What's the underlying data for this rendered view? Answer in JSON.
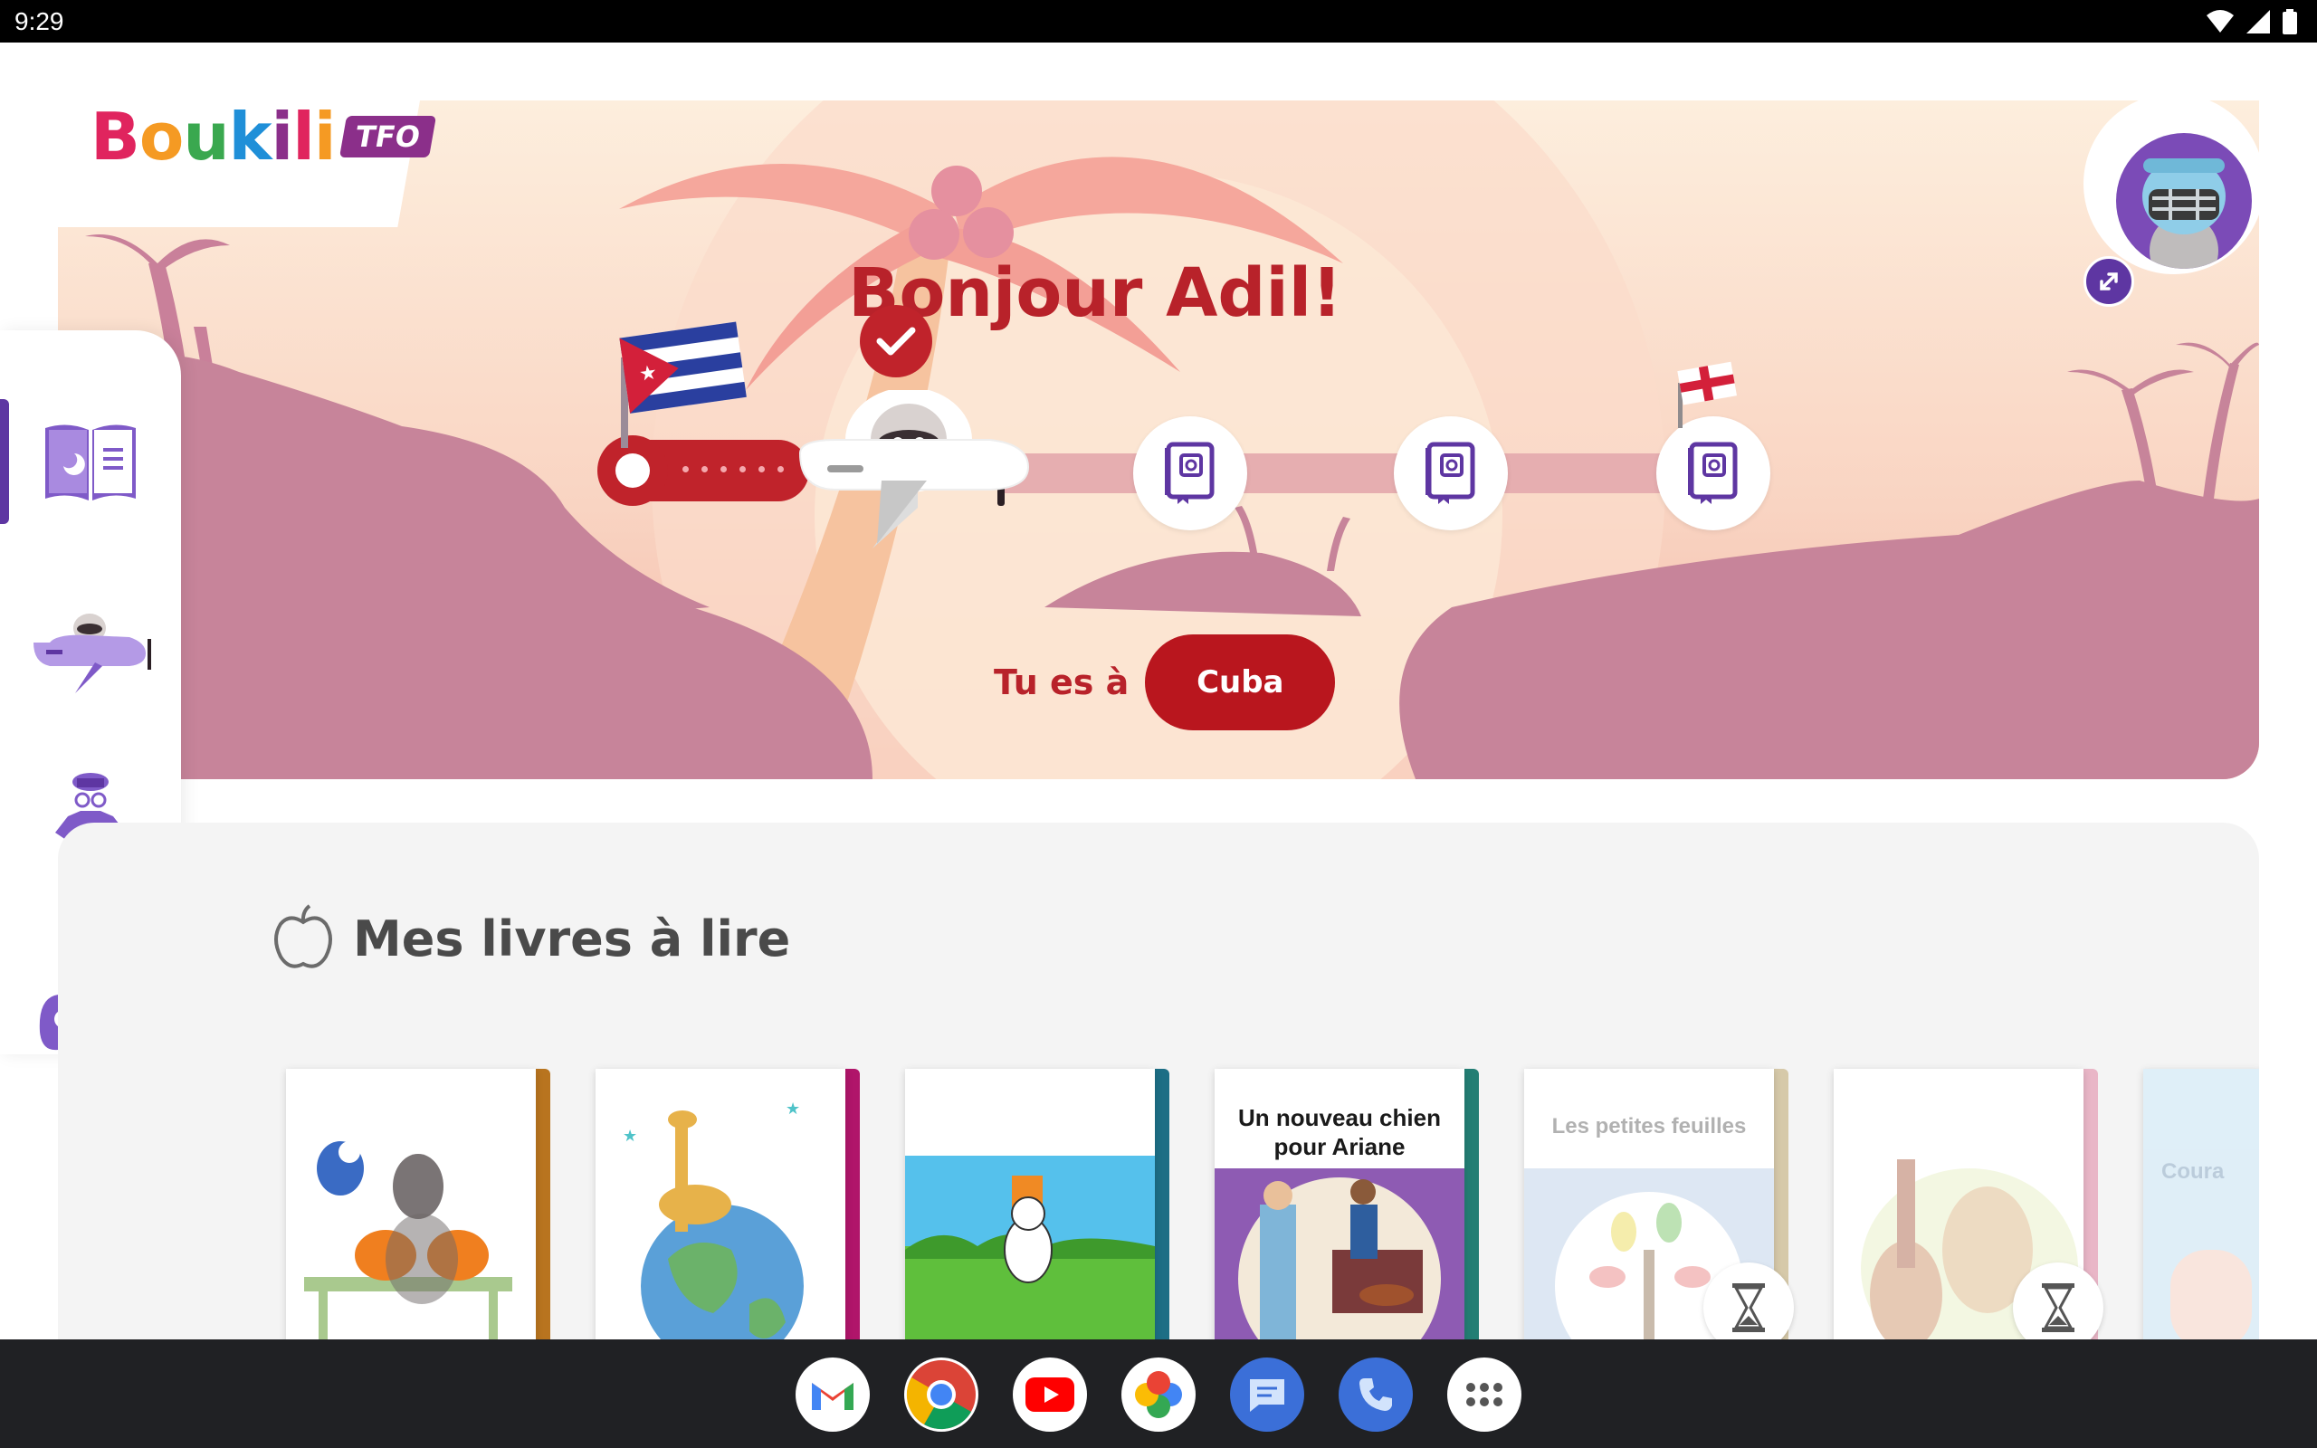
{
  "status_bar": {
    "time": "9:29"
  },
  "brand": {
    "name": "Boukili",
    "badge": "TFO"
  },
  "hero": {
    "greeting": "Bonjour Adil!",
    "location_label": "Tu es à",
    "location_value": "Cuba"
  },
  "sidebar": {
    "items": [
      {
        "name": "books",
        "icon": "book-icon",
        "active": true
      },
      {
        "name": "travel",
        "icon": "plane-icon",
        "active": false
      },
      {
        "name": "avatar",
        "icon": "avatar-outfit-icon",
        "active": false
      },
      {
        "name": "games",
        "icon": "gamepad-icon",
        "active": false
      }
    ]
  },
  "books_section": {
    "title": "Mes livres à lire",
    "books": [
      {
        "cover_title": "",
        "spine_color": "#b8741f",
        "locked": false
      },
      {
        "cover_title": "",
        "spine_color": "#b0156a",
        "locked": false
      },
      {
        "cover_title": "",
        "spine_color": "#1d6e85",
        "locked": false
      },
      {
        "cover_title": "Un nouveau chien pour Ariane",
        "spine_color": "#237e74",
        "locked": false
      },
      {
        "cover_title": "Les petites feuilles",
        "spine_color": "#d6c9a9",
        "locked": true
      },
      {
        "cover_title": "",
        "spine_color": "#e9b6c7",
        "locked": true
      },
      {
        "cover_title": "Coura",
        "spine_color": "#dddddd",
        "locked": true
      }
    ]
  },
  "colors": {
    "brand_red": "#b8222a",
    "brand_purple": "#5e36a2",
    "panel_gray": "#f4f4f4"
  },
  "dock": {
    "apps": [
      "gmail-icon",
      "chrome-icon",
      "youtube-icon",
      "photos-icon",
      "messages-icon",
      "phone-icon",
      "app-drawer-icon"
    ]
  }
}
